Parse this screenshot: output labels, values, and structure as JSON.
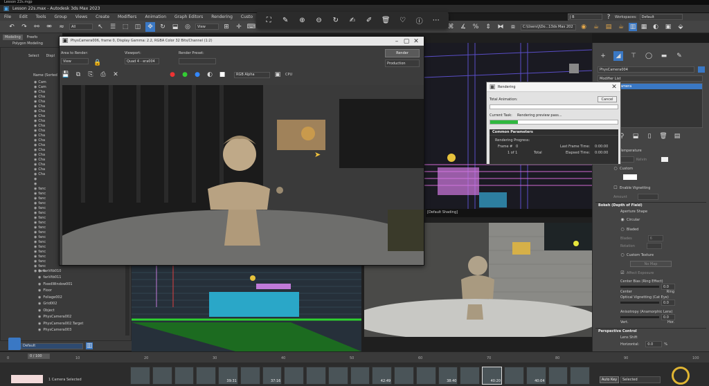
{
  "os_title": "Lesson 22s.mgp",
  "window_title": "Lesson 22s.max - Autodesk 3ds Max 2023",
  "menu": [
    "File",
    "Edit",
    "Tools",
    "Group",
    "Views",
    "Create",
    "Modifiers",
    "Animation",
    "Graph Editors",
    "Rendering",
    "Custo"
  ],
  "user": "J B",
  "workspaces_label": "Workspaces:",
  "workspace_value": "Default",
  "project_path": "C:\\Users\\J\\Do...13ds Max 202",
  "all_filter": "All",
  "view_dropdown": "View",
  "ribbon_tabs": [
    "Modeling",
    "Freefo"
  ],
  "ribbon_sub": "Polygon Modeling",
  "scene_explorer": {
    "tabs": [
      "Select",
      "Displ"
    ],
    "name_header": "Name (Sorted",
    "items": [
      "Cam",
      "Cam",
      "Cha",
      "Cha",
      "Cha",
      "Cha",
      "Cha",
      "Cha",
      "Cha",
      "Cha",
      "Cha",
      "Cha",
      "Cha",
      "Cha",
      "Cha",
      "Cha",
      "Cha",
      "Cha",
      "Cha",
      "Cha",
      "",
      "",
      "fanc",
      "fanc",
      "fanc",
      "fanc",
      "fanc",
      "fanc",
      "fanc",
      "fanc",
      "fanc",
      "fanc",
      "fanc",
      "fanc",
      "fanc",
      "fanc",
      "fanc",
      "fanc",
      "fanc",
      "fanc"
    ],
    "named_items": [
      "fanVtb010",
      "fanVtb011",
      "FixedWindow001",
      "Floor",
      "Foliage002",
      "Grid002",
      "Object",
      "PhysCamera002",
      "PhysCamera002.Target",
      "PhysCamera003"
    ],
    "bottom_dropdown": "Default"
  },
  "frame_window": {
    "title": "PhysCamera006, frame 0, Display Gamma: 2.2, RGBA Color 32 Bits/Channel (1:2)",
    "area_to_render_label": "Area to Render:",
    "area_to_render_value": "View",
    "viewport_label": "Viewport:",
    "viewport_value": "Quad 4 - era004",
    "render_preset_label": "Render Preset:",
    "render_preset_value": "",
    "render_button": "Render",
    "production_value": "Production",
    "channel_value": "RGB Alpha",
    "cpu_label": "CPU"
  },
  "floating_toolbar_icons": [
    "crop-icon",
    "edit-icon",
    "zoom-in-icon",
    "zoom-out-icon",
    "rotate-icon",
    "annotate-icon",
    "draw-icon",
    "delete-icon",
    "favorite-icon",
    "info-icon",
    "more-icon"
  ],
  "rendering_dialog": {
    "title": "Rendering",
    "total_animation_label": "Total Animation:",
    "cancel_button": "Cancel",
    "current_task_label": "Current Task:",
    "current_task_value": "Rendering preview pass...",
    "total_progress": 0,
    "task_progress": 0.22,
    "common_params_header": "Common Parameters",
    "rendering_progress_label": "Rendering Progress:",
    "frame_label": "Frame #",
    "frame_value": "0",
    "of_value": "1 of 1",
    "total_label": "Total",
    "last_frame_time_label": "Last Frame Time:",
    "last_frame_time_value": "0:00:00",
    "elapsed_time_label": "Elapsed Time:",
    "elapsed_time_value": "0:00:00"
  },
  "viewport_label": "[Default Shading]",
  "command_panel": {
    "object_name": "PhysCamera004",
    "modifier_list": "Modifier List",
    "camera_item": "amera",
    "temperature_label": "Temperature",
    "kelvin_label": "Kelvin",
    "custom_label": "Custom",
    "enable_vignetting": "Enable Vignetting",
    "amount_label": "Amount",
    "bokeh_header": "Bokeh (Depth of Field)",
    "aperture_shape": "Aperture Shape",
    "circular": "Circular",
    "bladed": "Bladed",
    "blades_label": "Blades",
    "blades_value": "6",
    "rotation_label": "Rotation",
    "custom_texture": "Custom Texture",
    "no_map": "No Map",
    "affect_exposure": "Affect Exposure",
    "center_bias_label": "Center Bias (Ring Effect)",
    "center_bias_value": "0.0",
    "center_label": "Center",
    "ring_label": "Ring",
    "optical_vignetting_label": "Optical Vignetting (Cat Eye)",
    "optical_vignetting_value": "0.0",
    "anisotropy_label": "Anisotropy (Anamorphic Lens)",
    "anisotropy_value": "0.0",
    "vert_label": "Vert.",
    "horiz_label": "Hor.",
    "perspective_header": "Perspective Control",
    "lens_shift_label": "Lens Shift",
    "horizontal_label": "Horizontal:",
    "horizontal_value": "0.0",
    "horizontal_unit": "%"
  },
  "timeline": {
    "frame_counter": "0 / 100",
    "ticks": [
      "0",
      "10",
      "20",
      "30",
      "40",
      "50",
      "60",
      "70",
      "80",
      "90",
      "100"
    ],
    "thumbnail_times": [
      "",
      "",
      "",
      "",
      "39:31",
      "",
      "37:16",
      "",
      "",
      "",
      "",
      "42:49",
      "",
      "",
      "38:40",
      "",
      "40:20",
      "",
      "40:04",
      "",
      ""
    ],
    "status_text": "1 Camera Selected",
    "auto_key": "Auto Key",
    "selected_dropdown": "Selected"
  },
  "colors": {
    "accent_blue": "#3a78c4",
    "progress_green": "#2fb83f",
    "window_dark": "#2b2b2b"
  }
}
